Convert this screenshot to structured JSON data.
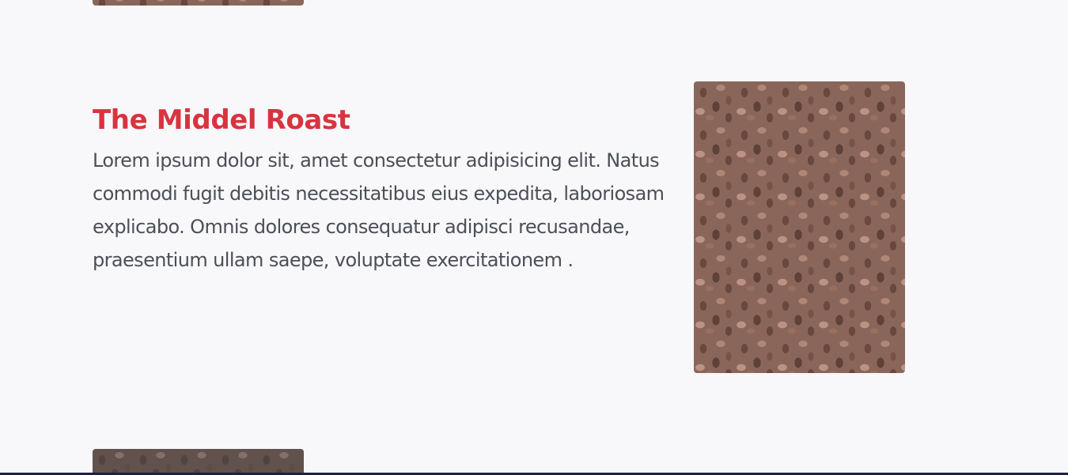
{
  "section": {
    "title": "The Middel Roast",
    "body": "Lorem ipsum dolor sit, amet consectetur adipisicing elit. Natus commodi fugit debitis necessitatibus eius expedita, laboriosam explicabo. Omnis dolores consequatur adipisci recusandae, praesentium ullam saepe, voluptate exercitationem ."
  },
  "colors": {
    "background": "#f8f8fb",
    "title": "#d8343f",
    "body_text": "#4b4f57",
    "bottom_bar": "#1d2240"
  }
}
